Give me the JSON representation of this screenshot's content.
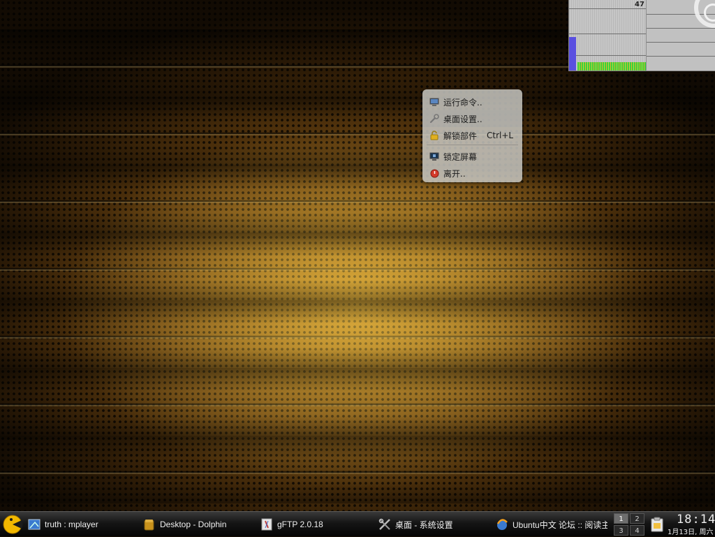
{
  "sysmon": {
    "value": "47"
  },
  "context_menu": {
    "items": [
      {
        "label": "运行命令..",
        "shortcut": "",
        "icon": "terminal-icon"
      },
      {
        "label": "桌面设置..",
        "shortcut": "",
        "icon": "wrench-icon"
      },
      {
        "label": "解锁部件",
        "shortcut": "Ctrl+L",
        "icon": "lock-icon"
      },
      {
        "label": "锁定屏幕",
        "shortcut": "",
        "icon": "monitor-lock-icon"
      },
      {
        "label": "离开..",
        "shortcut": "",
        "icon": "power-icon"
      }
    ]
  },
  "taskbar": {
    "tasks": [
      {
        "label": "truth : mplayer",
        "icon": "window-icon"
      },
      {
        "label": "Desktop - Dolphin",
        "icon": "folder-icon"
      },
      {
        "label": "gFTP 2.0.18",
        "icon": "ftp-icon"
      },
      {
        "label": "桌面 - 系统设置",
        "icon": "tools-icon"
      },
      {
        "label": "Ubuntu中文 论坛 :: 阅读主",
        "icon": "browser-icon"
      }
    ],
    "pager": [
      "1",
      "2",
      "3",
      "4"
    ],
    "clock": {
      "time": "18:14",
      "date": "1月13日, 周六"
    }
  },
  "colors": {
    "accent": "#f2b800",
    "menu_bg": "#cdcdc8"
  }
}
